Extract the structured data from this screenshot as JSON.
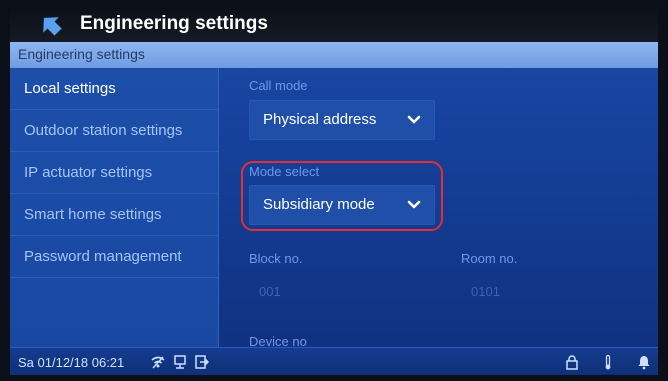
{
  "header": {
    "title": "Engineering settings"
  },
  "subbar": {
    "label": "Engineering settings"
  },
  "sidebar": {
    "items": [
      {
        "label": "Local settings",
        "active": true
      },
      {
        "label": "Outdoor station settings",
        "active": false
      },
      {
        "label": "IP actuator settings",
        "active": false
      },
      {
        "label": "Smart home settings",
        "active": false
      },
      {
        "label": "Password management",
        "active": false
      }
    ]
  },
  "content": {
    "call_mode": {
      "label": "Call mode",
      "value": "Physical address"
    },
    "mode_select": {
      "label": "Mode select",
      "value": "Subsidiary mode"
    },
    "block_no": {
      "label": "Block no.",
      "value": "001"
    },
    "room_no": {
      "label": "Room no.",
      "value": "0101"
    },
    "device_no": {
      "label": "Device no"
    }
  },
  "status": {
    "datetime": "Sa 01/12/18  06:21"
  },
  "colors": {
    "highlight": "#e0302f",
    "accent": "#1f4fa8",
    "label": "#6e99e8"
  }
}
